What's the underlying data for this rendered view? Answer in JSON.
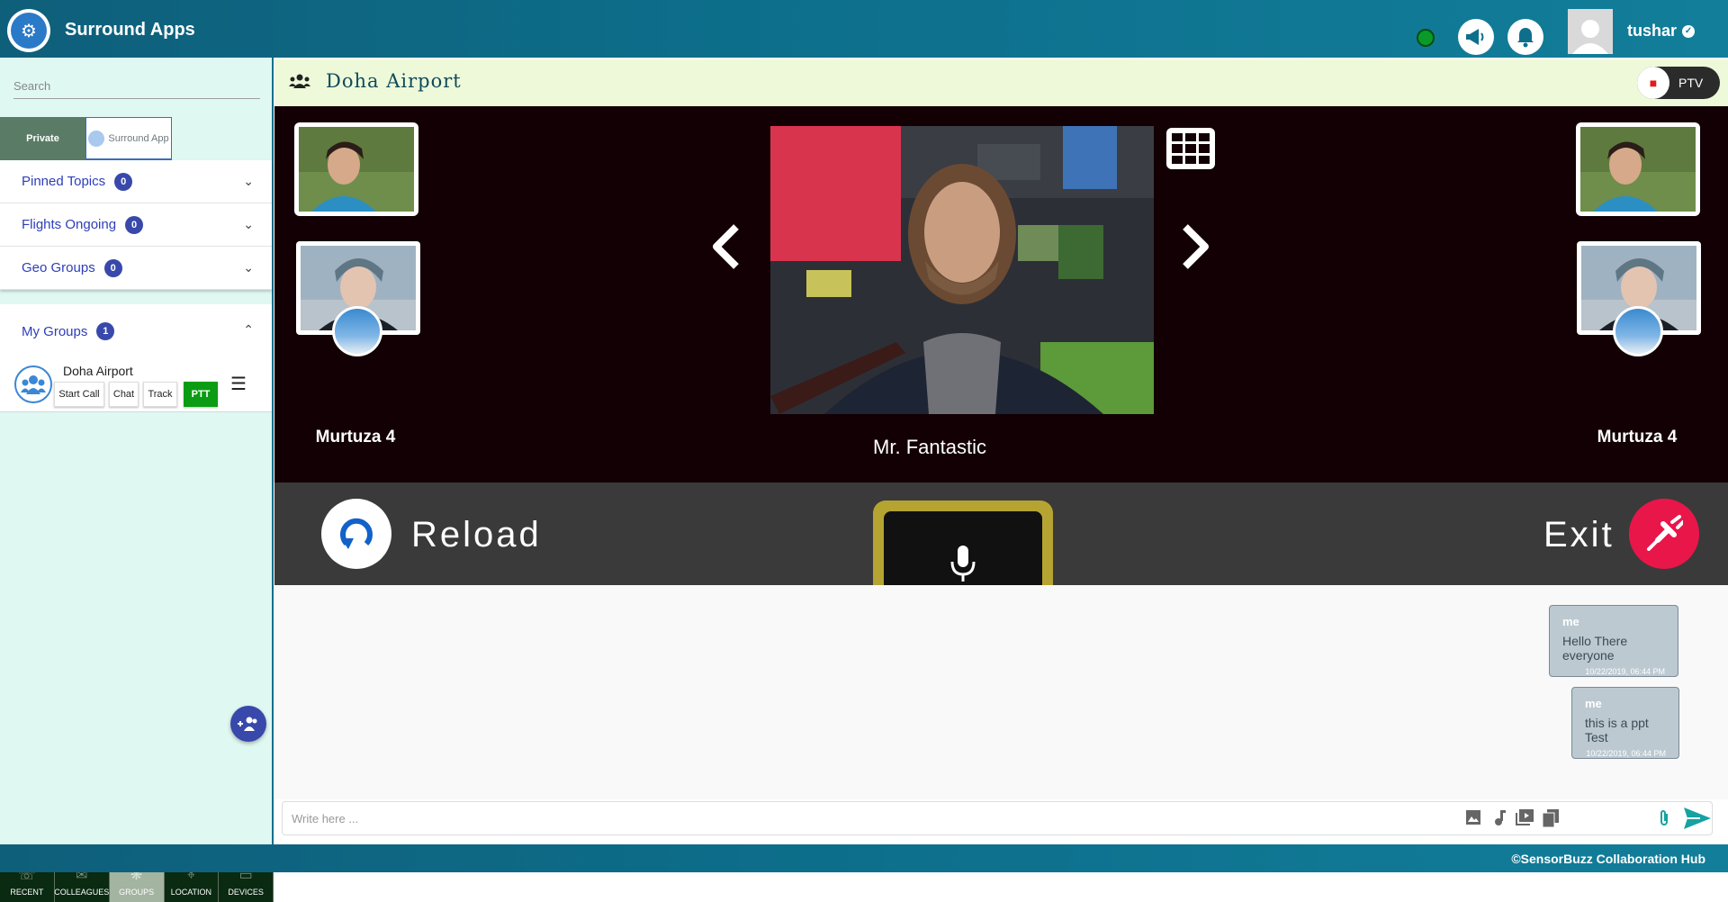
{
  "header": {
    "app_title": "Surround Apps",
    "user_name": "tushar",
    "status_color": "#0a9a2a"
  },
  "sidebar": {
    "search_placeholder": "Search",
    "tabs": [
      {
        "label": "Private"
      },
      {
        "label": "Surround App"
      }
    ],
    "sections": [
      {
        "label": "Pinned Topics",
        "count": "0"
      },
      {
        "label": "Flights Ongoing",
        "count": "0"
      },
      {
        "label": "Geo Groups",
        "count": "0"
      }
    ],
    "my_groups": {
      "label": "My Groups",
      "count": "1"
    },
    "group": {
      "name": "Doha Airport",
      "buttons": [
        "Start Call",
        "Chat",
        "Track",
        "PTT"
      ]
    },
    "bottom_nav": [
      {
        "label": "RECENT",
        "icon": "phone-icon"
      },
      {
        "label": "COLLEAGUES",
        "icon": "envelope-icon"
      },
      {
        "label": "GROUPS",
        "icon": "groups-icon",
        "active": true
      },
      {
        "label": "LOCATION",
        "icon": "location-pin-icon"
      },
      {
        "label": "DEVICES",
        "icon": "devices-icon"
      }
    ]
  },
  "main": {
    "group_title": "Doha Airport",
    "ptv_label": "PTV",
    "participants": {
      "left_name": "Murtuza 4",
      "right_name": "Murtuza 4",
      "center_name": "Mr. Fantastic"
    },
    "controls": {
      "reload_label": "Reload",
      "exit_label": "Exit"
    },
    "messages": [
      {
        "sender": "me",
        "text": "Hello There everyone",
        "time": "10/22/2019, 06:44 PM"
      },
      {
        "sender": "me",
        "text": "this is a ppt Test",
        "time": "10/22/2019, 06:44 PM"
      }
    ],
    "composer_placeholder": "Write here ..."
  },
  "footer": {
    "text": "©SensorBuzz Collaboration Hub"
  }
}
